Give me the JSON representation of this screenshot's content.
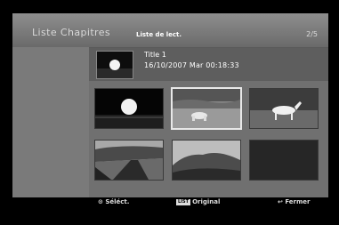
{
  "header": {
    "title": "Liste Chapitres",
    "subtitle": "Liste de lect.",
    "page": "2/5"
  },
  "info": {
    "title": "Title 1",
    "date_time": "16/10/2007  Mar  00:18:33"
  },
  "thumbnails": [
    {
      "id": "moon",
      "selected": false
    },
    {
      "id": "horse-grazing",
      "selected": true
    },
    {
      "id": "horse-white",
      "selected": false
    },
    {
      "id": "road",
      "selected": false
    },
    {
      "id": "cliffs",
      "selected": false
    },
    {
      "id": "empty",
      "selected": false
    }
  ],
  "footer": {
    "select_icon": "circle-select-icon",
    "select_label": "Séléct.",
    "list_badge": "LIST",
    "original_label": "Original",
    "close_icon": "return-icon",
    "close_label": "Fermer"
  },
  "colors": {
    "panel": "#6e6e6e",
    "selection_border": "#e8e8e8"
  }
}
